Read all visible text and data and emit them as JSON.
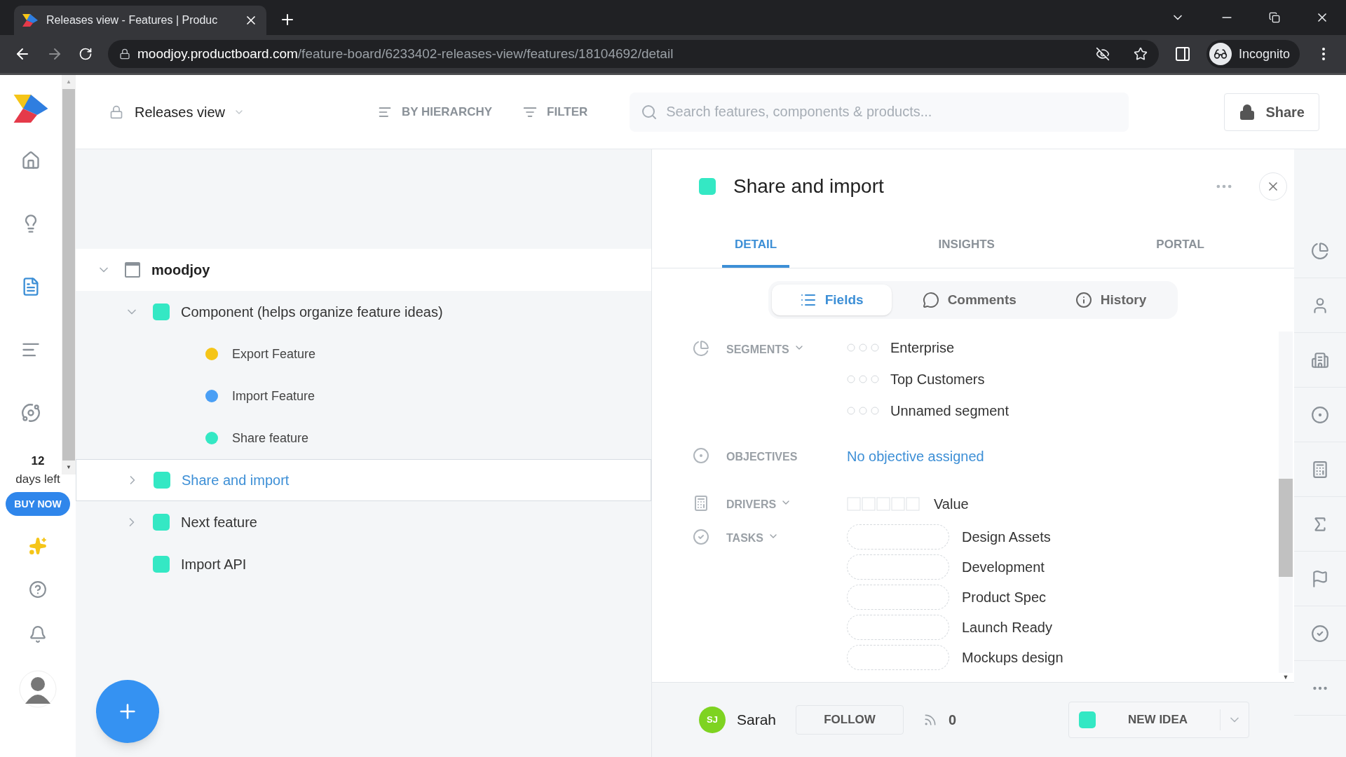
{
  "browser": {
    "tab_title": "Releases view - Features | Produc",
    "url_host": "moodjoy.productboard.com",
    "url_path": "/feature-board/6233402-releases-view/features/18104692/detail",
    "profile": "Incognito"
  },
  "nav_items": [
    {
      "selected": false
    },
    {
      "selected": false
    },
    {
      "selected": true
    },
    {
      "selected": false
    },
    {
      "selected": false
    }
  ],
  "trial": {
    "count": "12",
    "label": "days left",
    "button": "BUY NOW"
  },
  "header": {
    "view_name": "Releases view",
    "actions": [
      "BY HIERARCHY",
      "FILTER"
    ],
    "search_placeholder": "Search features, components & products...",
    "share": "Share"
  },
  "tree": [
    {
      "name": "moodjoy",
      "kind": "product",
      "expanded": true,
      "selected": false,
      "children": [
        {
          "name": "Component (helps organize feature ideas)",
          "kind": "feature",
          "color": "#34e8c4",
          "expanded": true,
          "selected": false,
          "children": [
            {
              "name": "Export Feature",
              "kind": "subfeature",
              "color": "#f5c518",
              "selected": false
            },
            {
              "name": "Import Feature",
              "kind": "subfeature",
              "color": "#4a9ff5",
              "selected": false
            },
            {
              "name": "Share feature",
              "kind": "subfeature",
              "color": "#34e8c4",
              "selected": false
            }
          ]
        },
        {
          "name": "Share and import",
          "kind": "feature",
          "color": "#34e8c4",
          "expanded": false,
          "selected": true
        },
        {
          "name": "Next feature",
          "kind": "feature",
          "color": "#34e8c4",
          "expanded": false,
          "selected": false
        },
        {
          "name": "Import API",
          "kind": "feature",
          "color": "#34e8c4",
          "selected": false
        }
      ]
    }
  ],
  "detail": {
    "title": "Share and import",
    "color": "#34e8c4",
    "tabs": [
      {
        "label": "DETAIL",
        "selected": true
      },
      {
        "label": "INSIGHTS",
        "selected": false
      },
      {
        "label": "PORTAL",
        "selected": false
      }
    ],
    "subtabs": [
      {
        "label": "Fields",
        "selected": true
      },
      {
        "label": "Comments",
        "selected": false
      },
      {
        "label": "History",
        "selected": false
      }
    ],
    "fields": [
      {
        "kind": "segments",
        "label": "SEGMENTS",
        "values": [
          "Enterprise",
          "Top Customers",
          "Unnamed segment"
        ]
      },
      {
        "kind": "objectives",
        "label": "OBJECTIVES",
        "values": [
          "No objective assigned"
        ]
      },
      {
        "kind": "drivers",
        "label": "DRIVERS",
        "values": [
          "Value"
        ]
      },
      {
        "kind": "tasks",
        "label": "TASKS",
        "values": [
          "Design Assets",
          "Development",
          "Product Spec",
          "Launch Ready",
          "Mockups design"
        ]
      }
    ],
    "footer": {
      "initials": "SJ",
      "user": "Sarah",
      "follow": "FOLLOW",
      "followers": "0",
      "new_idea": {
        "label": "NEW IDEA",
        "color": "#34e8c4"
      }
    }
  },
  "scroll_arrows": [
    "▲",
    "▼",
    "▼"
  ]
}
